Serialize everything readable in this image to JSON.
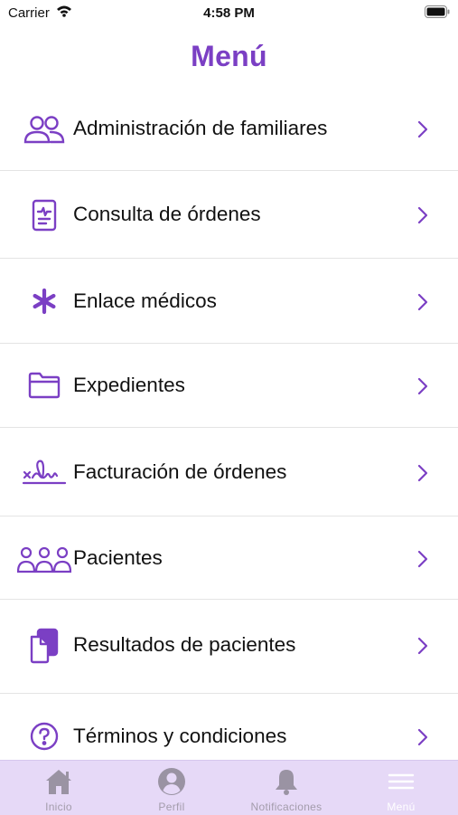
{
  "status_bar": {
    "carrier": "Carrier",
    "time": "4:58 PM"
  },
  "header": {
    "title": "Menú"
  },
  "menu": {
    "items": [
      {
        "label": "Administración de familiares",
        "icon": "family-icon"
      },
      {
        "label": "Consulta de órdenes",
        "icon": "order-document-icon"
      },
      {
        "label": "Enlace médicos",
        "icon": "asterisk-icon"
      },
      {
        "label": "Expedientes",
        "icon": "folder-icon"
      },
      {
        "label": "Facturación de órdenes",
        "icon": "signature-icon"
      },
      {
        "label": "Pacientes",
        "icon": "patients-icon"
      },
      {
        "label": "Resultados de pacientes",
        "icon": "results-icon"
      },
      {
        "label": "Términos y condiciones",
        "icon": "question-icon"
      }
    ]
  },
  "tab_bar": {
    "tabs": [
      {
        "label": "Inicio",
        "icon": "home-icon"
      },
      {
        "label": "Perfil",
        "icon": "profile-icon"
      },
      {
        "label": "Notificaciones",
        "icon": "bell-icon"
      },
      {
        "label": "Menú",
        "icon": "hamburger-icon"
      }
    ]
  },
  "colors": {
    "accent": "#7B3FC4",
    "tab_bar_bg": "#E6D9F7",
    "tab_inactive": "#a39cab",
    "divider": "#e4e4e4"
  }
}
